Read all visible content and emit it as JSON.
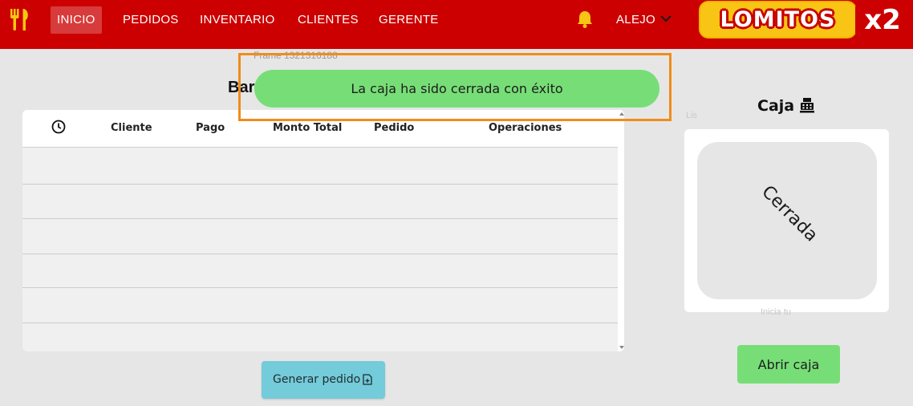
{
  "nav": {
    "items": [
      {
        "label": "INICIO",
        "active": true
      },
      {
        "label": "PEDIDOS",
        "active": false
      },
      {
        "label": "INVENTARIO",
        "active": false
      },
      {
        "label": "CLIENTES",
        "active": false
      },
      {
        "label": "GERENTE",
        "active": false
      }
    ],
    "user": "ALEJO",
    "brand": "LOMITOS",
    "brand_suffix": "x2",
    "colors": {
      "bar": "#cc0000",
      "brand_yellow": "#f8c514"
    }
  },
  "overlay": {
    "frame_label": "Frame 1321316188",
    "toast_message": "La caja ha sido cerrada con éxito"
  },
  "orders": {
    "title_partial": "Bar",
    "columns": [
      "Cliente",
      "Pago",
      "Monto Total",
      "Pedido",
      "Operaciones"
    ],
    "clock_column_icon": "clock-icon",
    "rows": 6,
    "generate_label": "Generar pedido"
  },
  "caja": {
    "title": "Caja",
    "status": "Cerrada",
    "open_button": "Abrir caja",
    "faint_top": "Lis",
    "faint_bottom": "Inicia tu"
  }
}
